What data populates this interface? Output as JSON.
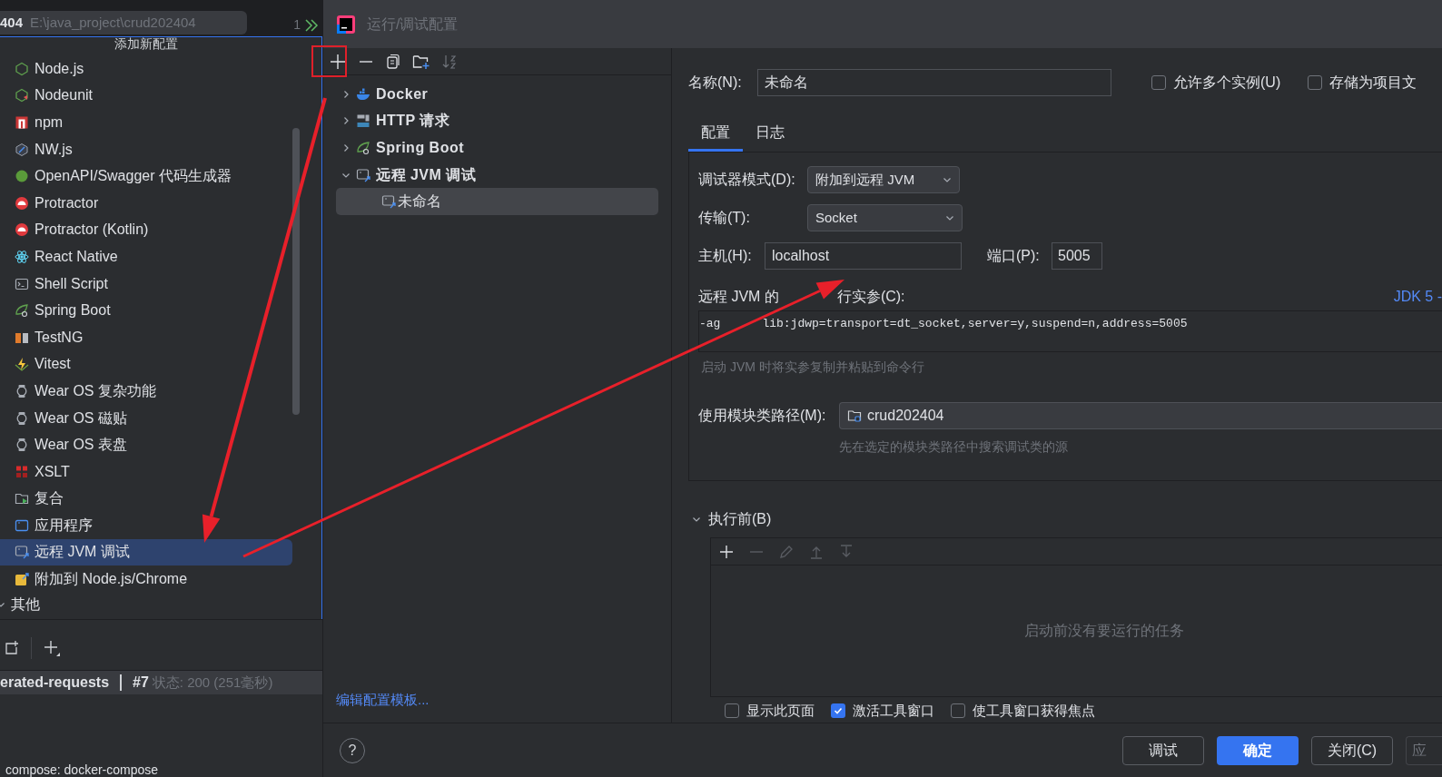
{
  "editor_tab": {
    "name": "404",
    "path": "E:\\java_project\\crud202404"
  },
  "gutter": {
    "line_number": "1"
  },
  "add_popup": {
    "title": "添加新配置",
    "items": [
      {
        "label": "Node.js",
        "kind": "nodejs",
        "selected": false
      },
      {
        "label": "Nodeunit",
        "kind": "nodeunit",
        "selected": false
      },
      {
        "label": "npm",
        "kind": "npm",
        "selected": false
      },
      {
        "label": "NW.js",
        "kind": "nwjs",
        "selected": false
      },
      {
        "label": "OpenAPI/Swagger 代码生成器",
        "kind": "openapi",
        "selected": false
      },
      {
        "label": "Protractor",
        "kind": "protractor",
        "selected": false
      },
      {
        "label": "Protractor (Kotlin)",
        "kind": "protractor",
        "selected": false
      },
      {
        "label": "React Native",
        "kind": "react",
        "selected": false
      },
      {
        "label": "Shell Script",
        "kind": "shell",
        "selected": false
      },
      {
        "label": "Spring Boot",
        "kind": "spring",
        "selected": false
      },
      {
        "label": "TestNG",
        "kind": "testng",
        "selected": false
      },
      {
        "label": "Vitest",
        "kind": "vitest",
        "selected": false
      },
      {
        "label": "Wear OS 复杂功能",
        "kind": "wearos",
        "selected": false
      },
      {
        "label": "Wear OS 磁贴",
        "kind": "wearos",
        "selected": false
      },
      {
        "label": "Wear OS 表盘",
        "kind": "wearos",
        "selected": false
      },
      {
        "label": "XSLT",
        "kind": "xslt",
        "selected": false
      },
      {
        "label": "复合",
        "kind": "compound",
        "selected": false
      },
      {
        "label": "应用程序",
        "kind": "application",
        "selected": false
      },
      {
        "label": "远程 JVM 调试",
        "kind": "remote",
        "selected": true
      },
      {
        "label": "附加到 Node.js/Chrome",
        "kind": "attach",
        "selected": false
      }
    ],
    "section": {
      "label": "其他",
      "expanded": true
    }
  },
  "bottom_panel": {
    "tab": "erated-requests",
    "request": "#7",
    "status": "状态: 200 (251毫秒)",
    "service": "compose: docker-compose"
  },
  "dialog": {
    "title": "运行/调试配置",
    "tree": [
      {
        "label": "Docker",
        "kind": "docker",
        "expanded": false
      },
      {
        "label": "HTTP 请求",
        "kind": "http",
        "expanded": false
      },
      {
        "label": "Spring Boot",
        "kind": "spring",
        "expanded": false
      },
      {
        "label": "远程 JVM 调试",
        "kind": "remote",
        "expanded": true,
        "children": [
          {
            "label": "未命名",
            "kind": "remote",
            "selected": true
          }
        ]
      }
    ],
    "template_link": "编辑配置模板...",
    "name_field": {
      "label": "名称(N):",
      "value": "未命名"
    },
    "options": [
      {
        "label": "允许多个实例(U)",
        "checked": false
      },
      {
        "label": "存储为项目文",
        "checked": false
      }
    ],
    "tabs": [
      {
        "label": "配置",
        "selected": true
      },
      {
        "label": "日志",
        "selected": false
      }
    ],
    "debugger_mode": {
      "label": "调试器模式(D):",
      "value": "附加到远程 JVM"
    },
    "transport": {
      "label": "传输(T):",
      "value": "Socket"
    },
    "host": {
      "label": "主机(H):",
      "value": "localhost"
    },
    "port": {
      "label": "端口(P):",
      "value": "5005"
    },
    "command_line": {
      "label_parts": [
        "远程 JVM 的",
        "行实参(C):"
      ],
      "jdk_link": "JDK 5 -",
      "value_parts": [
        "-ag",
        "lib:jdwp=transport=dt_socket,server=y,suspend=n,address=5005"
      ],
      "hint": "启动 JVM 时将实参复制并粘贴到命令行"
    },
    "module_classpath": {
      "label": "使用模块类路径(M):",
      "value": "crud202404",
      "hint": "先在选定的模块类路径中搜索调试类的源"
    },
    "before_launch": {
      "label": "执行前(B)",
      "expanded": true,
      "empty_text": "启动前没有要运行的任务"
    },
    "launch_options": [
      {
        "label": "显示此页面",
        "checked": false
      },
      {
        "label": "激活工具窗口",
        "checked": true
      },
      {
        "label": "使工具窗口获得焦点",
        "checked": false
      }
    ],
    "help": "?",
    "buttons": [
      {
        "label": "调试",
        "primary": false
      },
      {
        "label": "确定",
        "primary": true
      },
      {
        "label": "关闭(C)",
        "primary": false
      },
      {
        "label": "应",
        "primary": false
      }
    ]
  }
}
